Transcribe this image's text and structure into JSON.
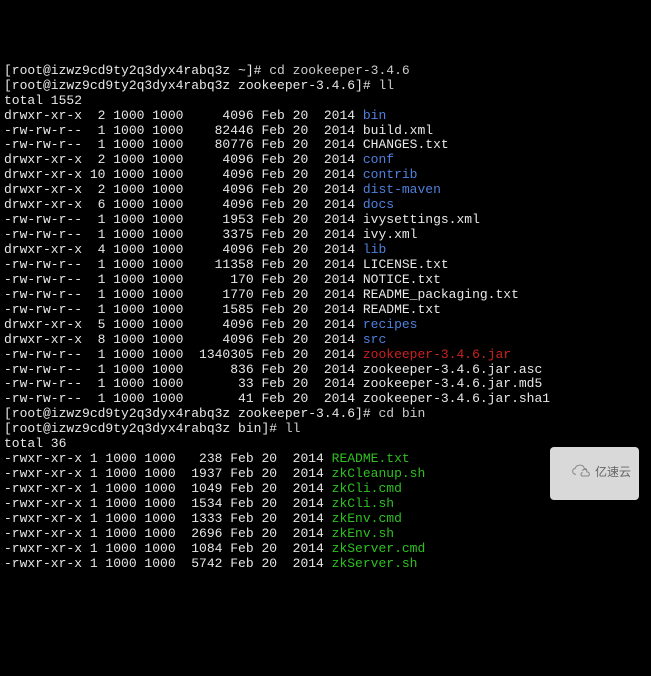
{
  "prompt1": "[root@izwz9cd9ty2q3dyx4rabq3z ~]# ",
  "cmd1": "cd zookeeper-3.4.6",
  "prompt2": "[root@izwz9cd9ty2q3dyx4rabq3z zookeeper-3.4.6]# ",
  "cmd2": "ll",
  "total1": "total 1552",
  "listing1": [
    {
      "perms": "drwxr-xr-x  2 1000 1000",
      "size": "    4096",
      "date": " Feb 20  2014 ",
      "name": "bin",
      "color": "blue"
    },
    {
      "perms": "-rw-rw-r--  1 1000 1000",
      "size": "   82446",
      "date": " Feb 20  2014 ",
      "name": "build.xml",
      "color": "white"
    },
    {
      "perms": "-rw-rw-r--  1 1000 1000",
      "size": "   80776",
      "date": " Feb 20  2014 ",
      "name": "CHANGES.txt",
      "color": "white"
    },
    {
      "perms": "drwxr-xr-x  2 1000 1000",
      "size": "    4096",
      "date": " Feb 20  2014 ",
      "name": "conf",
      "color": "blue"
    },
    {
      "perms": "drwxr-xr-x 10 1000 1000",
      "size": "    4096",
      "date": " Feb 20  2014 ",
      "name": "contrib",
      "color": "blue"
    },
    {
      "perms": "drwxr-xr-x  2 1000 1000",
      "size": "    4096",
      "date": " Feb 20  2014 ",
      "name": "dist-maven",
      "color": "blue"
    },
    {
      "perms": "drwxr-xr-x  6 1000 1000",
      "size": "    4096",
      "date": " Feb 20  2014 ",
      "name": "docs",
      "color": "blue"
    },
    {
      "perms": "-rw-rw-r--  1 1000 1000",
      "size": "    1953",
      "date": " Feb 20  2014 ",
      "name": "ivysettings.xml",
      "color": "white"
    },
    {
      "perms": "-rw-rw-r--  1 1000 1000",
      "size": "    3375",
      "date": " Feb 20  2014 ",
      "name": "ivy.xml",
      "color": "white"
    },
    {
      "perms": "drwxr-xr-x  4 1000 1000",
      "size": "    4096",
      "date": " Feb 20  2014 ",
      "name": "lib",
      "color": "blue"
    },
    {
      "perms": "-rw-rw-r--  1 1000 1000",
      "size": "   11358",
      "date": " Feb 20  2014 ",
      "name": "LICENSE.txt",
      "color": "white"
    },
    {
      "perms": "-rw-rw-r--  1 1000 1000",
      "size": "     170",
      "date": " Feb 20  2014 ",
      "name": "NOTICE.txt",
      "color": "white"
    },
    {
      "perms": "-rw-rw-r--  1 1000 1000",
      "size": "    1770",
      "date": " Feb 20  2014 ",
      "name": "README_packaging.txt",
      "color": "white"
    },
    {
      "perms": "-rw-rw-r--  1 1000 1000",
      "size": "    1585",
      "date": " Feb 20  2014 ",
      "name": "README.txt",
      "color": "white"
    },
    {
      "perms": "drwxr-xr-x  5 1000 1000",
      "size": "    4096",
      "date": " Feb 20  2014 ",
      "name": "recipes",
      "color": "blue"
    },
    {
      "perms": "drwxr-xr-x  8 1000 1000",
      "size": "    4096",
      "date": " Feb 20  2014 ",
      "name": "src",
      "color": "blue"
    },
    {
      "perms": "-rw-rw-r--  1 1000 1000",
      "size": " 1340305",
      "date": " Feb 20  2014 ",
      "name": "zookeeper-3.4.6.jar",
      "color": "red"
    },
    {
      "perms": "-rw-rw-r--  1 1000 1000",
      "size": "     836",
      "date": " Feb 20  2014 ",
      "name": "zookeeper-3.4.6.jar.asc",
      "color": "white"
    },
    {
      "perms": "-rw-rw-r--  1 1000 1000",
      "size": "      33",
      "date": " Feb 20  2014 ",
      "name": "zookeeper-3.4.6.jar.md5",
      "color": "white"
    },
    {
      "perms": "-rw-rw-r--  1 1000 1000",
      "size": "      41",
      "date": " Feb 20  2014 ",
      "name": "zookeeper-3.4.6.jar.sha1",
      "color": "white"
    }
  ],
  "prompt3": "[root@izwz9cd9ty2q3dyx4rabq3z zookeeper-3.4.6]# ",
  "cmd3": "cd bin",
  "prompt4": "[root@izwz9cd9ty2q3dyx4rabq3z bin]# ",
  "cmd4": "ll",
  "total2": "total 36",
  "listing2": [
    {
      "perms": "-rwxr-xr-x 1 1000 1000",
      "size": "  238",
      "date": " Feb 20  2014 ",
      "name": "README.txt",
      "color": "green"
    },
    {
      "perms": "-rwxr-xr-x 1 1000 1000",
      "size": " 1937",
      "date": " Feb 20  2014 ",
      "name": "zkCleanup.sh",
      "color": "green"
    },
    {
      "perms": "-rwxr-xr-x 1 1000 1000",
      "size": " 1049",
      "date": " Feb 20  2014 ",
      "name": "zkCli.cmd",
      "color": "green"
    },
    {
      "perms": "-rwxr-xr-x 1 1000 1000",
      "size": " 1534",
      "date": " Feb 20  2014 ",
      "name": "zkCli.sh",
      "color": "green"
    },
    {
      "perms": "-rwxr-xr-x 1 1000 1000",
      "size": " 1333",
      "date": " Feb 20  2014 ",
      "name": "zkEnv.cmd",
      "color": "green"
    },
    {
      "perms": "-rwxr-xr-x 1 1000 1000",
      "size": " 2696",
      "date": " Feb 20  2014 ",
      "name": "zkEnv.sh",
      "color": "green"
    },
    {
      "perms": "-rwxr-xr-x 1 1000 1000",
      "size": " 1084",
      "date": " Feb 20  2014 ",
      "name": "zkServer.cmd",
      "color": "green"
    },
    {
      "perms": "-rwxr-xr-x 1 1000 1000",
      "size": " 5742",
      "date": " Feb 20  2014 ",
      "name": "zkServer.sh",
      "color": "green"
    }
  ],
  "watermark_text": "亿速云"
}
